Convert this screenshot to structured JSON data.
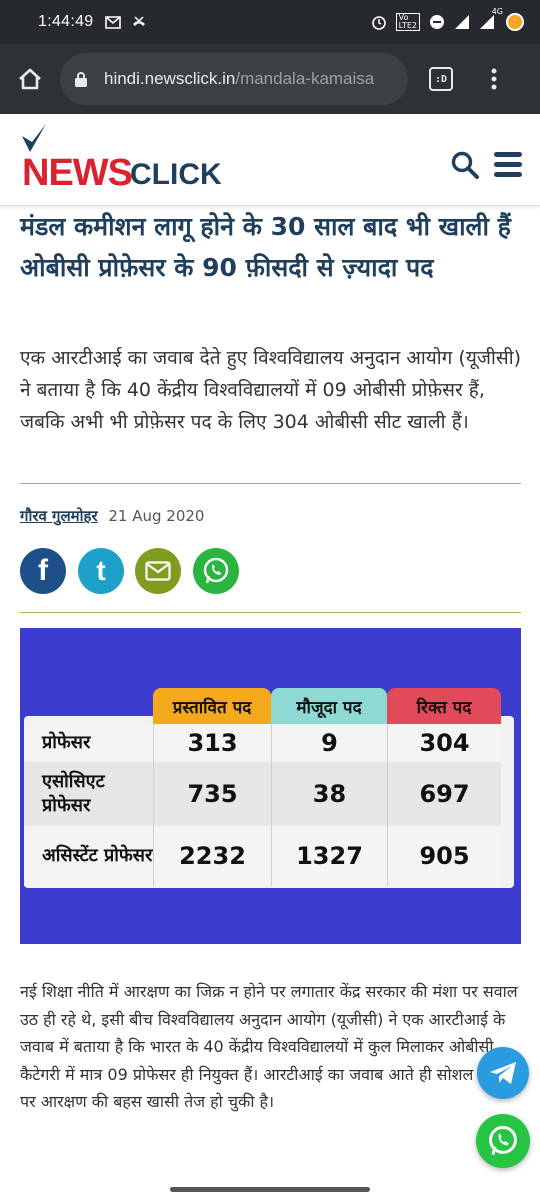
{
  "status_bar": {
    "time": "1:44:49",
    "lte_top": "Vo",
    "lte_bottom": "LTE2",
    "net_label": "4G"
  },
  "browser": {
    "url_host": "hindi.newsclick.in",
    "url_path": "/mandala-kamaisa",
    "tabs_label": ":D"
  },
  "site": {
    "logo_news": "NEWS",
    "logo_click": "CLICK"
  },
  "article": {
    "headline": "मंडल कमीशन लागू होने के 30 साल बाद भी खाली हैं ओबीसी प्रोफ़ेसर के 90 फ़ीसदी से ज़्यादा पद",
    "summary": "एक आरटीआई का जवाब देते हुए विश्वविद्यालय अनुदान आयोग (यूजीसी) ने बताया है कि 40 केंद्रीय विश्वविद्यालयों में 09 ओबीसी प्रोफ़ेसर हैं, जबकि अभी भी प्रोफ़ेसर पद के लिए 304 ओबीसी सीट खाली हैं।",
    "author": "गौरव गुलमोहर",
    "date": "21 Aug 2020",
    "body": "नई शिक्षा नीति में आरक्षण का जिक्र न होने पर लगातार केंद्र सरकार की मंशा पर सवाल उठ ही रहे थे, इसी बीच विश्वविद्यालय अनुदान आयोग (यूजीसी) ने एक आरटीआई के जवाब में बताया है कि भारत के 40 केंद्रीय विश्वविद्यालयों में कुल मिलाकर ओबीसी कैटेगरी में मात्र 09 प्रोफेसर ही नियुक्त हैं। आरटीआई का जवाब आते ही सोशल मीडिया पर आरक्षण की बहस खासी तेज हो चुकी है।"
  },
  "share": {
    "fb_glyph": "f",
    "tw_glyph": "t"
  },
  "infographic": {
    "headers": [
      "प्रस्तावित पद",
      "मौजूदा पद",
      "रिक्त पद"
    ],
    "rows": [
      {
        "label": "प्रोफेसर",
        "values": [
          "313",
          "9",
          "304"
        ]
      },
      {
        "label": "एसोसिएट प्रोफेसर",
        "values": [
          "735",
          "38",
          "697"
        ]
      },
      {
        "label": "असिस्टेंट प्रोफेसर",
        "values": [
          "2232",
          "1327",
          "905"
        ]
      }
    ],
    "colors": {
      "background": "#3c3ccf",
      "proposed": "#f3a91b",
      "current": "#8fd9d4",
      "vacant": "#e24a5c"
    }
  },
  "colors": {
    "headline": "#1f3f5c",
    "brand_red": "#d9232e",
    "rule": "#b5ab54"
  }
}
